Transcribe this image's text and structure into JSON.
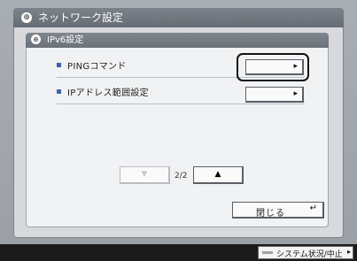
{
  "window": {
    "outer_title": "ネットワーク設定",
    "inner_title": "IPv6設定",
    "title_icon": "network-icon"
  },
  "items": [
    {
      "label": "PINGコマンド",
      "selected": true
    },
    {
      "label": "IPアドレス範囲設定",
      "selected": false
    }
  ],
  "pager": {
    "page": "2/2",
    "prev_disabled": true
  },
  "close_button": {
    "label": "閉じる"
  },
  "status_button": {
    "label": "システム状況/中止"
  },
  "colors": {
    "bullet": "#3b63a8",
    "title_bar": "#6c7279",
    "panel": "#f1f2f4"
  }
}
